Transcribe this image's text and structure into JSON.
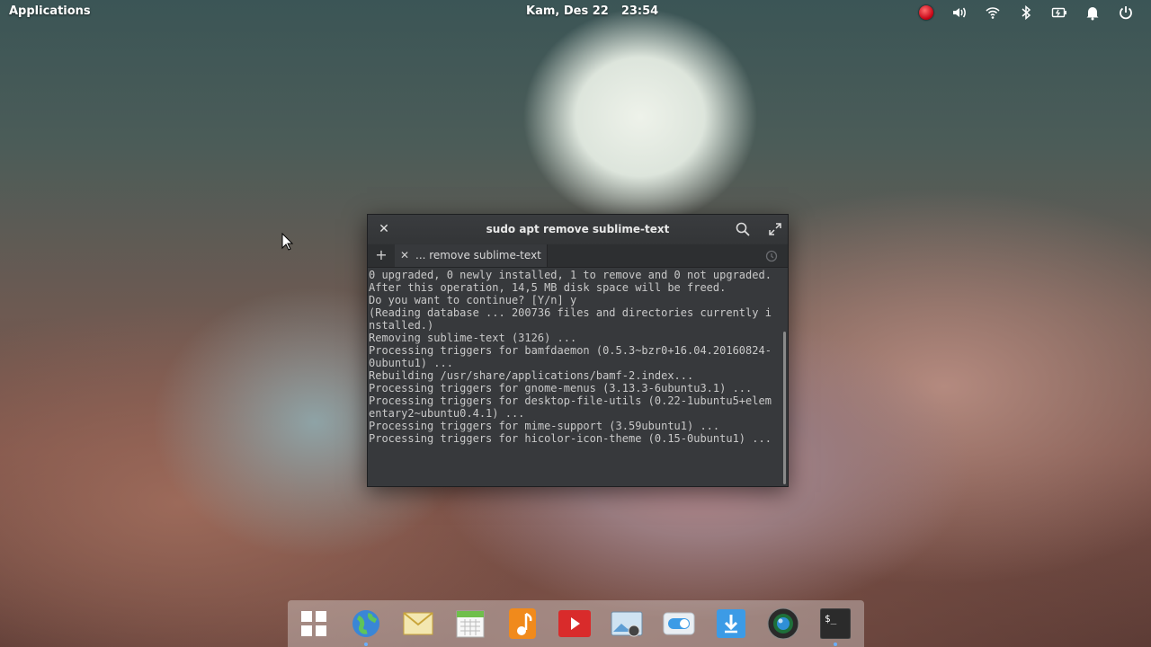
{
  "top_panel": {
    "applications_label": "Applications",
    "date": "Kam, Des 22",
    "time": "23:54",
    "indicators": [
      "record-indicator",
      "volume-icon",
      "wifi-icon",
      "bluetooth-icon",
      "battery-icon",
      "notifications-icon",
      "power-icon"
    ]
  },
  "terminal": {
    "title": "sudo apt remove sublime-text",
    "tab_label": "... remove sublime-text",
    "lines": [
      "0 upgraded, 0 newly installed, 1 to remove and 0 not upgraded.",
      "After this operation, 14,5 MB disk space will be freed.",
      "Do you want to continue? [Y/n] y",
      "(Reading database ... 200736 files and directories currently i",
      "nstalled.)",
      "Removing sublime-text (3126) ...",
      "Processing triggers for bamfdaemon (0.5.3~bzr0+16.04.20160824-",
      "0ubuntu1) ...",
      "Rebuilding /usr/share/applications/bamf-2.index...",
      "Processing triggers for gnome-menus (3.13.3-6ubuntu3.1) ...",
      "Processing triggers for desktop-file-utils (0.22-1ubuntu5+elem",
      "entary2~ubuntu0.4.1) ...",
      "Processing triggers for mime-support (3.59ubuntu1) ...",
      "Processing triggers for hicolor-icon-theme (0.15-0ubuntu1) ..."
    ]
  },
  "dock": {
    "items": [
      {
        "name": "multitasking-view-icon",
        "color": "#3a8ee6"
      },
      {
        "name": "web-browser-icon",
        "color": "#2f7fd0"
      },
      {
        "name": "mail-icon",
        "color": "#e8c24a"
      },
      {
        "name": "calendar-icon",
        "color": "#f2f2f2"
      },
      {
        "name": "music-icon",
        "color": "#f08a1c"
      },
      {
        "name": "videos-icon",
        "color": "#d92b2b"
      },
      {
        "name": "photos-icon",
        "color": "#6fb1e0"
      },
      {
        "name": "settings-icon",
        "color": "#e9eef3"
      },
      {
        "name": "appcenter-icon",
        "color": "#3c9be6"
      },
      {
        "name": "camera-icon",
        "color": "#2a2a2a"
      },
      {
        "name": "terminal-icon",
        "color": "#2b2b2b"
      }
    ],
    "terminal_glyph": "$_"
  }
}
